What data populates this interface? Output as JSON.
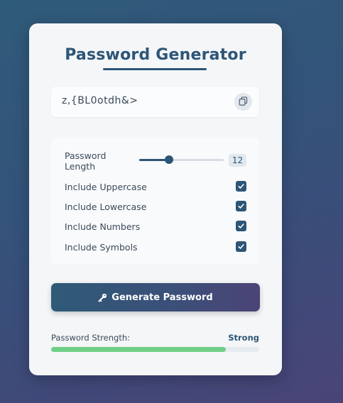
{
  "app": {
    "title": "Password Generator"
  },
  "password": {
    "value": "z,{BL0otdh&>",
    "copy_icon": "copy-icon"
  },
  "options": {
    "length_label": "Password Length",
    "length_value": "12",
    "length_min": 1,
    "length_max": 32,
    "uppercase_label": "Include Uppercase",
    "lowercase_label": "Include Lowercase",
    "numbers_label": "Include Numbers",
    "symbols_label": "Include Symbols",
    "uppercase_checked": true,
    "lowercase_checked": true,
    "numbers_checked": true,
    "symbols_checked": true
  },
  "generate": {
    "label": "Generate Password",
    "icon": "key-icon"
  },
  "strength": {
    "label": "Password Strength:",
    "value": "Strong",
    "level": 0.84
  },
  "colors": {
    "accent": "#2d5577",
    "strength_fill": "#6fcf87"
  }
}
